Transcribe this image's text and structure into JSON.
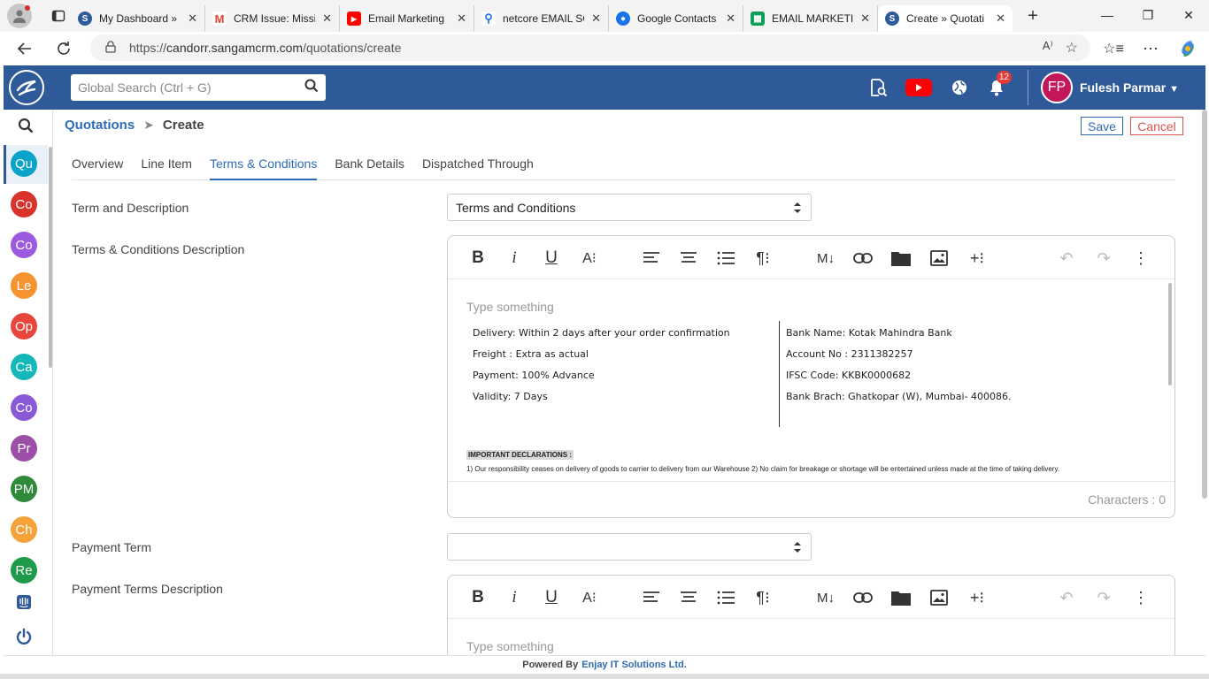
{
  "browser": {
    "tabs": [
      {
        "title": "My Dashboard »",
        "color": "#2f5a9a"
      },
      {
        "title": "CRM Issue: Missi",
        "color": "#ea4335"
      },
      {
        "title": "Email Marketing",
        "color": "#ff0000"
      },
      {
        "title": "netcore EMAIL SC",
        "color": "#1a73e8"
      },
      {
        "title": "Google Contacts",
        "color": "#1a73e8"
      },
      {
        "title": "EMAIL MARKETIN",
        "color": "#0f9d58"
      },
      {
        "title": "Create » Quotati",
        "color": "#2f5a9a"
      }
    ],
    "url_scheme": "https://",
    "url_host": "candorr.sangamcrm.com",
    "url_path": "/quotations/create"
  },
  "header": {
    "search_placeholder": "Global Search (Ctrl + G)",
    "notification_count": "12",
    "avatar_initials": "FP",
    "user_name": "Fulesh Parmar"
  },
  "rail": {
    "items": [
      {
        "label": "Qu",
        "color": "#0aa3c9"
      },
      {
        "label": "Co",
        "color": "#d9342b"
      },
      {
        "label": "Co",
        "color": "#9c5ae0"
      },
      {
        "label": "Le",
        "color": "#f59331"
      },
      {
        "label": "Op",
        "color": "#e8453c"
      },
      {
        "label": "Ca",
        "color": "#14b8b8"
      },
      {
        "label": "Co",
        "color": "#8a5ad6"
      },
      {
        "label": "Pr",
        "color": "#9b4fa6"
      },
      {
        "label": "PM",
        "color": "#2e8b3a"
      },
      {
        "label": "Ch",
        "color": "#f5a23a"
      },
      {
        "label": "Re",
        "color": "#1e9b4a"
      }
    ]
  },
  "page": {
    "breadcrumb_root": "Quotations",
    "breadcrumb_current": "Create",
    "save_label": "Save",
    "cancel_label": "Cancel",
    "tabs": [
      "Overview",
      "Line Item",
      "Terms & Conditions",
      "Bank Details",
      "Dispatched Through"
    ],
    "active_tab": "Terms & Conditions"
  },
  "form": {
    "term_label": "Term and Description",
    "term_value": "Terms and Conditions",
    "tc_desc_label": "Terms & Conditions Description",
    "payment_term_label": "Payment Term",
    "payment_term_value": "",
    "payment_desc_label": "Payment Terms Description"
  },
  "editor1": {
    "placeholder": "Type something",
    "left_lines": [
      "Delivery: Within 2 days after your order confirmation",
      "Freight : Extra as actual",
      "Payment: 100% Advance",
      "Validity:  7 Days"
    ],
    "right_lines": [
      "Bank Name:   Kotak Mahindra Bank",
      "Account No : 2311382257",
      "IFSC Code:     KKBK0000682",
      "Bank Brach: Ghatkopar (W), Mumbai- 400086."
    ],
    "declarations_title": "IMPORTANT DECLARATIONS :",
    "declarations_line1": "1) Our responsibility ceases on delivery of goods to carrier to delivery from our Warehouse 2) No claim for breakage or shortage will be entertained unless made at the time of taking delivery.",
    "characters_label": "Characters : 0"
  },
  "editor2": {
    "placeholder": "Type something"
  },
  "footer": {
    "prefix": "Powered By",
    "company": "Enjay IT Solutions Ltd."
  }
}
